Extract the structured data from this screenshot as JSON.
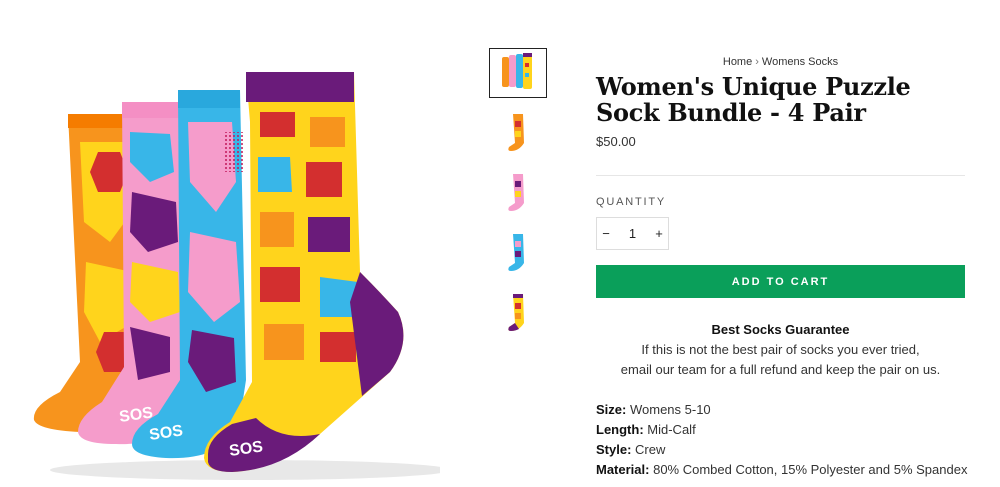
{
  "gallery": {
    "thumbnails": [
      {
        "name": "bundle",
        "active": true
      },
      {
        "name": "orange-sock",
        "active": false
      },
      {
        "name": "pink-sock",
        "active": false
      },
      {
        "name": "blue-sock",
        "active": false
      },
      {
        "name": "purple-sock",
        "active": false
      }
    ]
  },
  "breadcrumb": {
    "home": "Home",
    "separator": "›",
    "category": "Womens Socks"
  },
  "product": {
    "title": "Women's Unique Puzzle Sock Bundle - 4 Pair",
    "price": "$50.00"
  },
  "quantity": {
    "label": "QUANTITY",
    "minus": "−",
    "value": "1",
    "plus": "+"
  },
  "cart": {
    "label": "ADD TO CART",
    "color": "#0a9f5a"
  },
  "guarantee": {
    "title": "Best Socks Guarantee",
    "line1": "If this is not the best pair of socks you ever tried,",
    "line2": "email our team for a full refund and keep the pair on us."
  },
  "specs": [
    {
      "key": "Size:",
      "value": "Womens 5-10"
    },
    {
      "key": "Length:",
      "value": "Mid-Calf"
    },
    {
      "key": "Style:",
      "value": "Crew"
    },
    {
      "key": "Material:",
      "value": "80% Combed Cotton, 15% Polyester and 5% Spandex"
    }
  ],
  "sock_text": "SOS",
  "colors": {
    "orange": "#f7941d",
    "pink": "#f59ccb",
    "blue": "#38b6e8",
    "purple": "#6a1b7a",
    "yellow": "#ffd41c"
  }
}
